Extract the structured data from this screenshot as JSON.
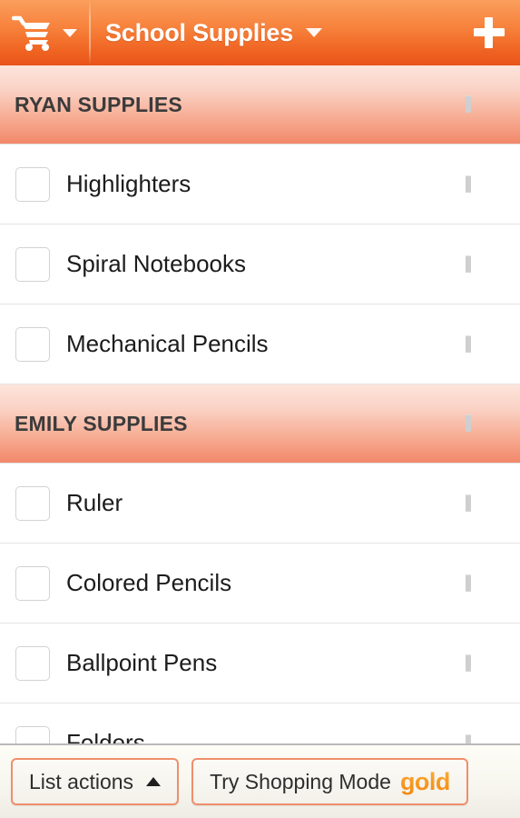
{
  "appbar": {
    "cart_icon": "shopping-cart-icon",
    "cart_caret_icon": "chevron-down-icon",
    "title": "School Supplies",
    "title_caret_icon": "chevron-down-icon",
    "add_icon": "plus-icon",
    "colors": {
      "gradient_top": "#fa9e5d",
      "gradient_bottom": "#e9531a",
      "title_color": "#ffffff"
    }
  },
  "list": {
    "handle_icon": "drag-handle-icon",
    "sections": [
      {
        "title": "RYAN SUPPLIES",
        "items": [
          {
            "label": "Highlighters",
            "checked": false
          },
          {
            "label": "Spiral Notebooks",
            "checked": false
          },
          {
            "label": "Mechanical Pencils",
            "checked": false
          }
        ]
      },
      {
        "title": "EMILY SUPPLIES",
        "items": [
          {
            "label": "Ruler",
            "checked": false
          },
          {
            "label": "Colored Pencils",
            "checked": false
          },
          {
            "label": "Ballpoint Pens",
            "checked": false
          },
          {
            "label": "Folders",
            "checked": false
          }
        ]
      }
    ],
    "colors": {
      "section_gradient_top": "#fde4db",
      "section_gradient_bottom": "#f2886a",
      "section_title_color": "#3b3b3b",
      "row_text_color": "#1c1c1c",
      "row_divider": "#e4e4e4"
    }
  },
  "action_bar": {
    "list_actions_label": "List actions",
    "list_actions_caret_icon": "caret-up-icon",
    "shopping_mode_label": "Try Shopping Mode",
    "shopping_mode_badge": "gold",
    "colors": {
      "button_border": "#ef8e6c",
      "gold_color": "#f7941e",
      "bar_background": "#f7f6ef"
    }
  }
}
